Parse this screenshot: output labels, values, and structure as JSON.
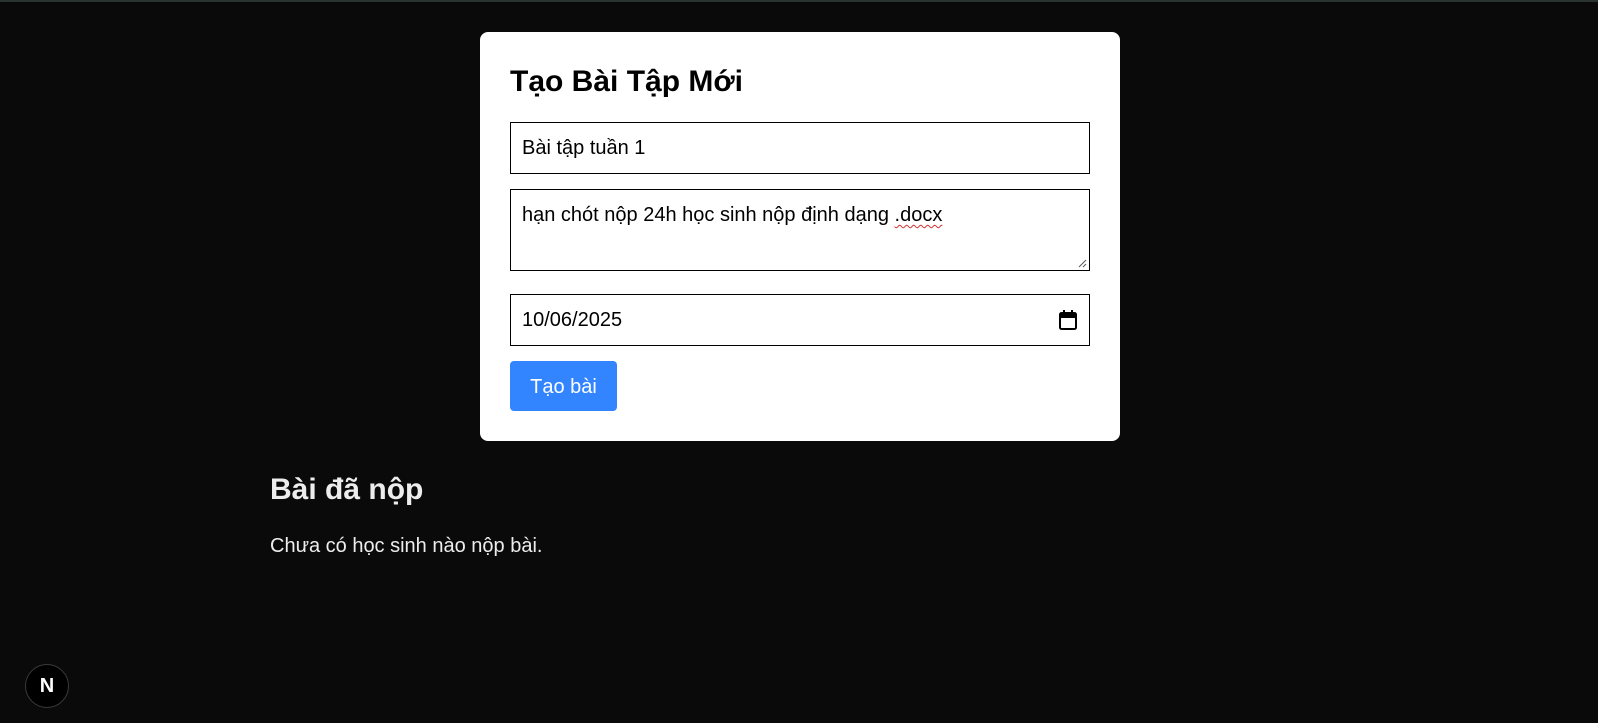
{
  "form": {
    "title": "Tạo Bài Tập Mới",
    "title_input_value": "Bài tập tuần 1",
    "description_value_prefix": "hạn chót nộp 24h học sinh nộp định dạng ",
    "description_value_flagged": ".docx",
    "due_date_value": "10/06/2025",
    "submit_label": "Tạo bài"
  },
  "submissions": {
    "heading": "Bài đã nộp",
    "empty_message": "Chưa có học sinh nào nộp bài."
  },
  "dev_badge": {
    "label": "N"
  },
  "colors": {
    "background": "#0a0a0a",
    "card": "#ffffff",
    "primary_button": "#3385ff",
    "text_light": "#ededed"
  },
  "icons": {
    "date_picker": "calendar-icon",
    "textarea_resize": "resize-grip-icon",
    "dev_badge": "nextjs-logo-icon"
  }
}
